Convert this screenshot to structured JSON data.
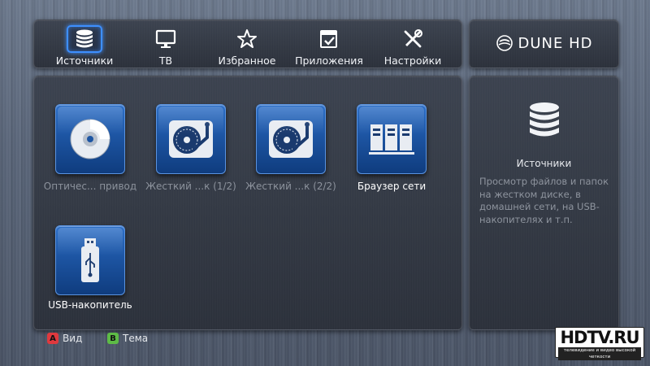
{
  "nav": {
    "items": [
      {
        "label": "Источники",
        "icon": "database-icon",
        "selected": true
      },
      {
        "label": "ТВ",
        "icon": "tv-icon",
        "selected": false
      },
      {
        "label": "Избранное",
        "icon": "star-icon",
        "selected": false
      },
      {
        "label": "Приложения",
        "icon": "apps-icon",
        "selected": false
      },
      {
        "label": "Настройки",
        "icon": "tools-icon",
        "selected": false
      }
    ]
  },
  "logo": {
    "text": "DUNE HD"
  },
  "sources": {
    "tiles": [
      {
        "label": "Оптичес... привод",
        "icon": "optical-disc-icon",
        "enabled": false
      },
      {
        "label": "Жесткий ...к (1/2)",
        "icon": "hard-disk-icon",
        "enabled": false
      },
      {
        "label": "Жесткий ...к (2/2)",
        "icon": "hard-disk-icon",
        "enabled": false
      },
      {
        "label": "Браузер сети",
        "icon": "network-servers-icon",
        "enabled": true
      },
      {
        "label": "USB-накопитель",
        "icon": "usb-drive-icon",
        "enabled": true
      }
    ]
  },
  "info": {
    "title": "Источники",
    "description": "Просмотр файлов и папок на жестком диске, в домашней сети, на USB-накопителях и т.п.",
    "icon": "database-icon"
  },
  "hints": [
    {
      "key": "A",
      "label": "Вид",
      "color": "#e0393e"
    },
    {
      "key": "B",
      "label": "Тема",
      "color": "#5dbb46"
    }
  ],
  "watermark": {
    "main": "HDTV.RU",
    "sub": "телевидение и видео высокой четкости"
  },
  "colors": {
    "accent": "#3d8fff",
    "tile": "#1d55a3"
  }
}
